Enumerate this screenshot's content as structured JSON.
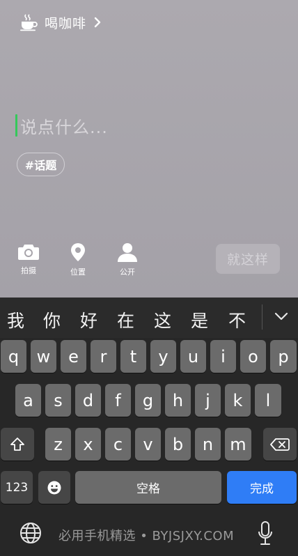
{
  "composer": {
    "mood_label": "喝咖啡",
    "placeholder": "说点什么...",
    "topic_chip": "#话题",
    "tools": [
      {
        "label": "拍摄",
        "icon": "camera-icon"
      },
      {
        "label": "位置",
        "icon": "location-pin-icon"
      },
      {
        "label": "公开",
        "icon": "person-icon"
      }
    ],
    "submit_label": "就这样",
    "caret_color": "#35c85a"
  },
  "keyboard": {
    "candidates": [
      "我",
      "你",
      "好",
      "在",
      "这",
      "是",
      "不"
    ],
    "row1": [
      "q",
      "w",
      "e",
      "r",
      "t",
      "y",
      "u",
      "i",
      "o",
      "p"
    ],
    "row2": [
      "a",
      "s",
      "d",
      "f",
      "g",
      "h",
      "j",
      "k",
      "l"
    ],
    "row3": [
      "z",
      "x",
      "c",
      "v",
      "b",
      "n",
      "m"
    ],
    "numbers_label": "123",
    "space_label": "空格",
    "done_label": "完成",
    "done_color": "#2f7df6",
    "shift_icon": "shift-icon",
    "delete_icon": "backspace-icon",
    "emoji_icon": "emoji-icon",
    "globe_icon": "globe-icon",
    "mic_icon": "microphone-icon",
    "watermark": "必用手机精选 • BYJSJXY.COM"
  }
}
